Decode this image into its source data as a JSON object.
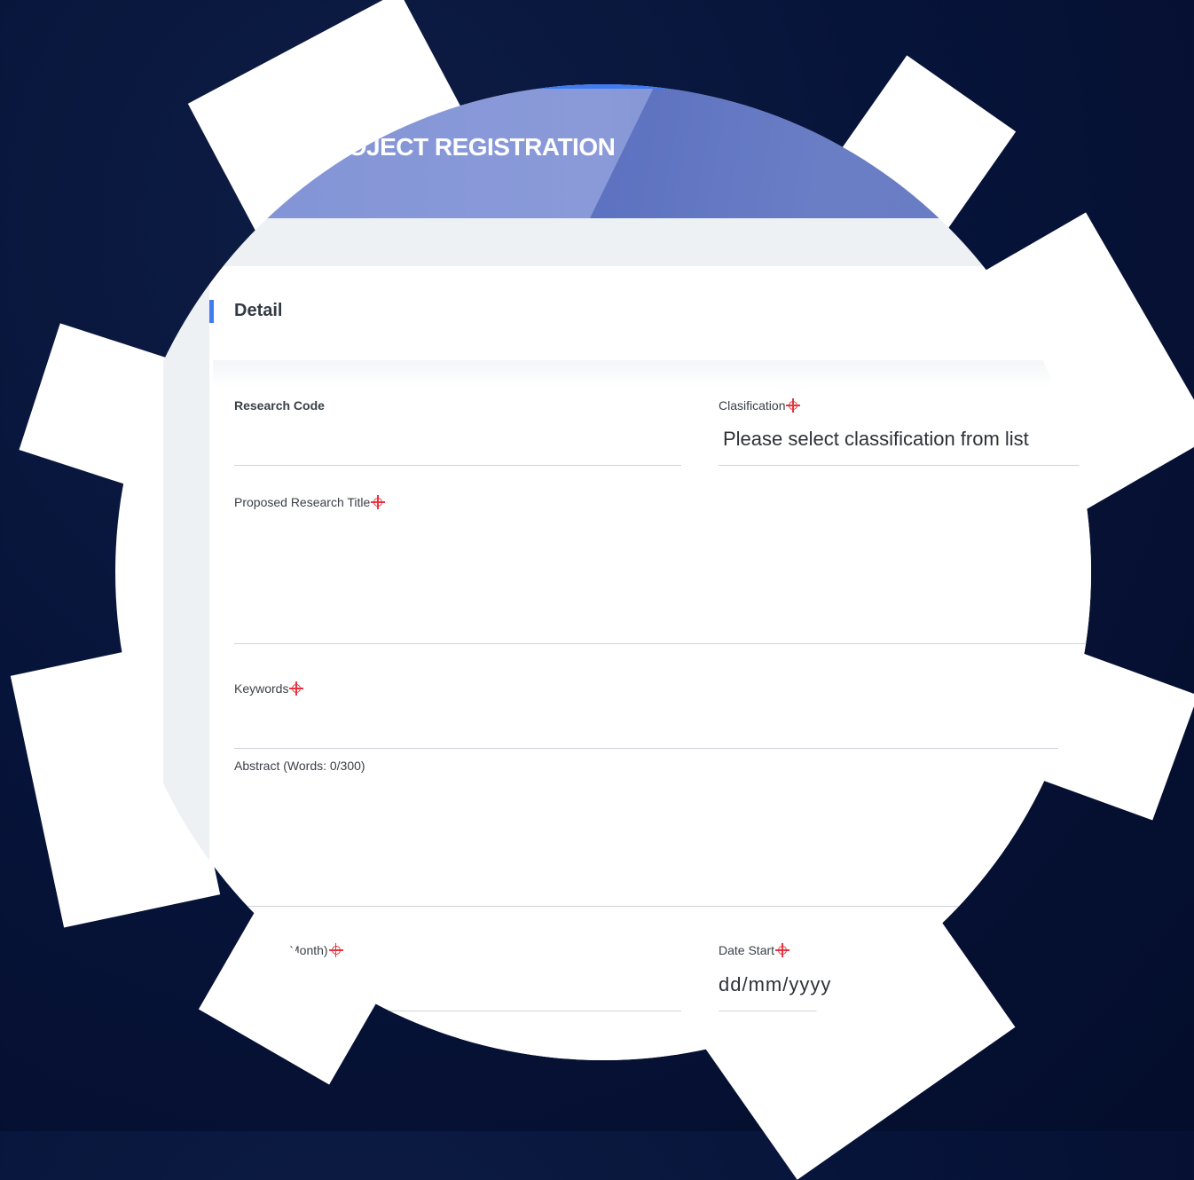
{
  "header": {
    "title": "ROJECT REGISTRATION"
  },
  "section": {
    "title": "Detail"
  },
  "fields": {
    "research_code": {
      "label": "Research Code",
      "value": ""
    },
    "classification": {
      "label": "Clasification",
      "placeholder": "Please select classification from list"
    },
    "proposed_title": {
      "label": "Proposed Research Title",
      "value": ""
    },
    "keywords": {
      "label": "Keywords",
      "value": ""
    },
    "abstract": {
      "label": "Abstract (Words: 0/300)",
      "value": ""
    },
    "duration": {
      "label": "Month)",
      "value": ""
    },
    "date_start": {
      "label": "Date Start",
      "placeholder": "dd/mm/yyyy"
    }
  },
  "colors": {
    "background": "#061136",
    "header": "#8a9ad8",
    "accent": "#3f7cf0",
    "required": "#e8343f"
  }
}
